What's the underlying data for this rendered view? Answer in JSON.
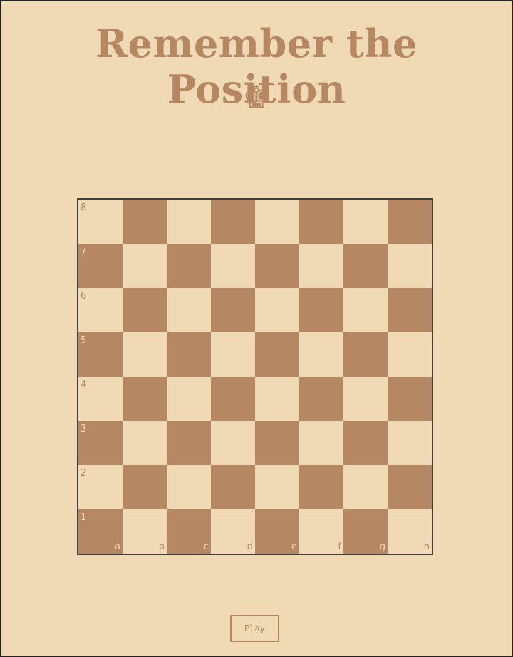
{
  "title": "Remember the Position",
  "king_glyph": "♚",
  "icons": {
    "king": "chess-king-icon"
  },
  "colors": {
    "light_square": "#f0d9b5",
    "dark_square": "#b58863",
    "border": "#404040"
  },
  "board": {
    "ranks": [
      "8",
      "7",
      "6",
      "5",
      "4",
      "3",
      "2",
      "1"
    ],
    "files": [
      "a",
      "b",
      "c",
      "d",
      "e",
      "f",
      "g",
      "h"
    ]
  },
  "play_button": {
    "label": "Play"
  }
}
